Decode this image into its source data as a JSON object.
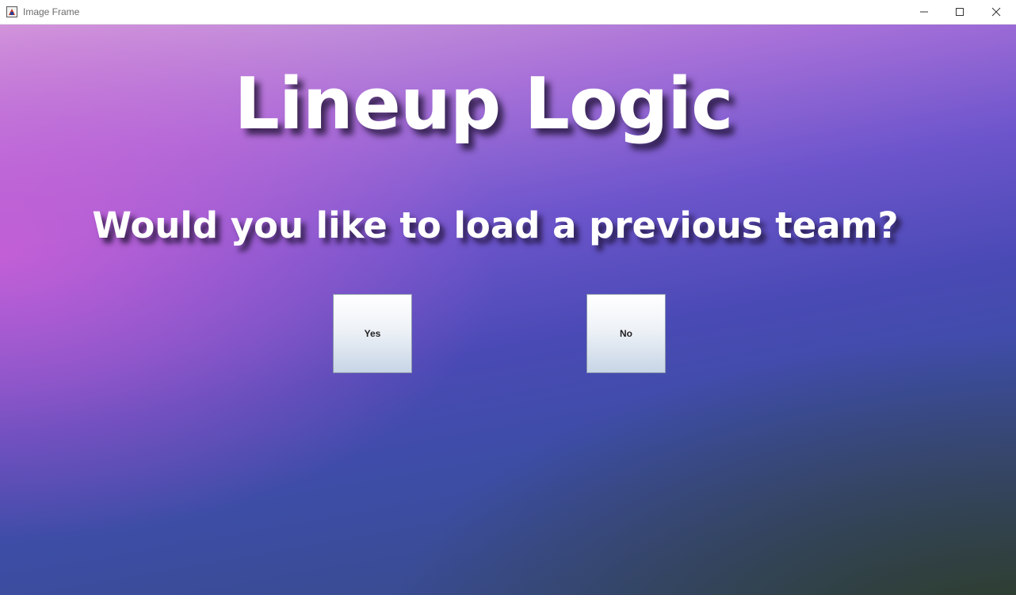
{
  "window": {
    "title": "Image Frame",
    "controls": {
      "minimize_icon": "minimize-icon",
      "maximize_icon": "maximize-icon",
      "close_icon": "close-icon"
    }
  },
  "main": {
    "app_title": "Lineup Logic",
    "prompt": "Would you like to load a previous team?",
    "buttons": {
      "yes_label": "Yes",
      "no_label": "No"
    }
  },
  "colors": {
    "title_text": "#ffffff",
    "gradient_top_left": "#d39fdb",
    "gradient_mid": "#4a4ab5",
    "gradient_bottom_right": "#2d3c23"
  }
}
